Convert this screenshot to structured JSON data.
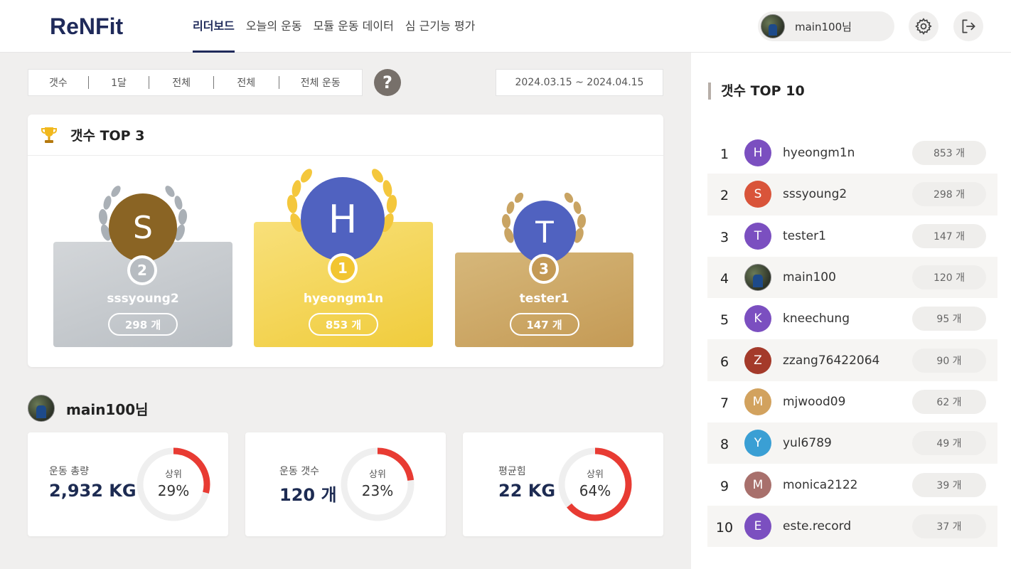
{
  "header": {
    "logo_text": "ReNFit",
    "nav": [
      "리더보드",
      "오늘의 운동",
      "모듈 운동 데이터",
      "심 근기능 평가"
    ],
    "user_name": "main100님"
  },
  "filters": {
    "items": [
      "갯수",
      "1달",
      "전체",
      "전체",
      "전체 운동"
    ],
    "help": "?",
    "date_range": "2024.03.15 ~ 2024.04.15"
  },
  "top3": {
    "title": "갯수 TOP 3",
    "first": {
      "initial": "H",
      "rank": "1",
      "name": "hyeongm1n",
      "count": "853 개"
    },
    "second": {
      "initial": "S",
      "rank": "2",
      "name": "sssyoung2",
      "count": "298 개"
    },
    "third": {
      "initial": "T",
      "rank": "3",
      "name": "tester1",
      "count": "147 개"
    }
  },
  "me": {
    "name": "main100님",
    "stats": [
      {
        "label": "운동 총량",
        "value": "2,932 KG",
        "caption": "상위",
        "percent_text": "29%",
        "percent": 29
      },
      {
        "label": "운동 갯수",
        "value": "120 개",
        "caption": "상위",
        "percent_text": "23%",
        "percent": 23
      },
      {
        "label": "평균힘",
        "value": "22 KG",
        "caption": "상위",
        "percent_text": "64%",
        "percent": 64
      }
    ]
  },
  "top10": {
    "title": "갯수 TOP 10",
    "rows": [
      {
        "rank": "1",
        "initial": "H",
        "name": "hyeongm1n",
        "count": "853 개",
        "color": "#7b4fc0"
      },
      {
        "rank": "2",
        "initial": "S",
        "name": "sssyoung2",
        "count": "298 개",
        "color": "#d9543a"
      },
      {
        "rank": "3",
        "initial": "T",
        "name": "tester1",
        "count": "147 개",
        "color": "#7b4fc0"
      },
      {
        "rank": "4",
        "initial": "",
        "name": "main100",
        "count": "120 개",
        "color": "photo"
      },
      {
        "rank": "5",
        "initial": "K",
        "name": "kneechung",
        "count": "95 개",
        "color": "#7b4fc0"
      },
      {
        "rank": "6",
        "initial": "Z",
        "name": "zzang76422064",
        "count": "90 개",
        "color": "#a43a2a"
      },
      {
        "rank": "7",
        "initial": "M",
        "name": "mjwood09",
        "count": "62 개",
        "color": "#d2a25e"
      },
      {
        "rank": "8",
        "initial": "Y",
        "name": "yul6789",
        "count": "49 개",
        "color": "#3a9fd4"
      },
      {
        "rank": "9",
        "initial": "M",
        "name": "monica2122",
        "count": "39 개",
        "color": "#a8706c"
      },
      {
        "rank": "10",
        "initial": "E",
        "name": "este.record",
        "count": "37 개",
        "color": "#7b4fc0"
      }
    ]
  },
  "colors": {
    "primary_navy": "#1f2a5a",
    "gold": "#f2cf48",
    "silver": "#c2c6ca",
    "bronze": "#c9a463",
    "winner_blue": "#5062c0",
    "silver_avatar": "#8a6424",
    "donut_red": "#e83b33"
  },
  "icons": [
    "settings-gear-icon",
    "logout-icon",
    "trophy-icon",
    "laurel-icon",
    "help-icon"
  ]
}
